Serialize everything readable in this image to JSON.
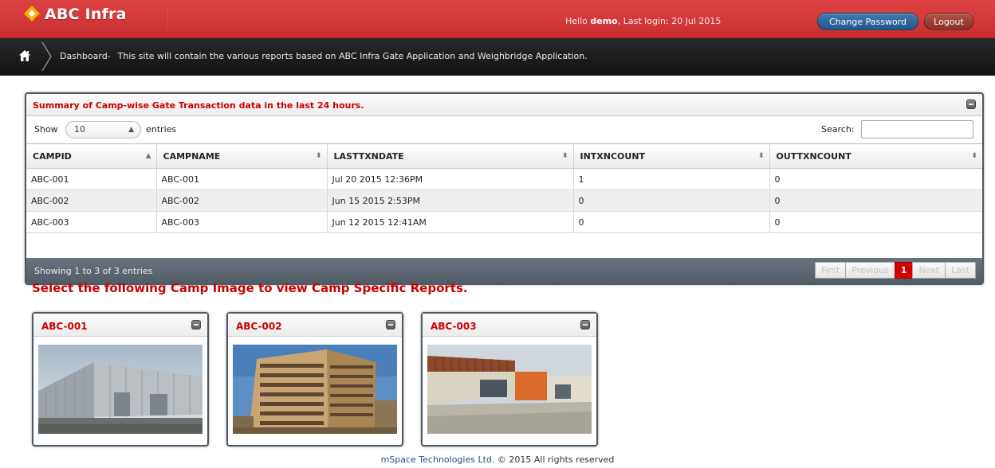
{
  "header": {
    "app_title": "ABC Infra",
    "greeting_prefix": "Hello ",
    "username": "demo",
    "last_login": ", Last login: 20 Jul 2015",
    "change_password_label": "Change Password",
    "logout_label": "Logout"
  },
  "breadcrumb": {
    "page": "Dashboard-",
    "description": "This site will contain the various reports based on ABC Infra Gate Application and Weighbridge Application."
  },
  "summary": {
    "title": "Summary of Camp-wise Gate Transaction data in the last 24 hours.",
    "show_label": "Show",
    "page_length": "10",
    "entries_label": "entries",
    "search_label": "Search:",
    "search_value": "",
    "columns": [
      "CAMPID",
      "CAMPNAME",
      "LASTTXNDATE",
      "INTXNCOUNT",
      "OUTTXNCOUNT"
    ],
    "rows": [
      [
        "ABC-001",
        "ABC-001",
        "Jul 20 2015 12:36PM",
        "1",
        "0"
      ],
      [
        "ABC-002",
        "ABC-002",
        "Jun 15 2015 2:53PM",
        "0",
        "0"
      ],
      [
        "ABC-003",
        "ABC-003",
        "Jun 12 2015 12:41AM",
        "0",
        "0"
      ]
    ],
    "info": "Showing 1 to 3 of 3 entries",
    "pager": {
      "first": "First",
      "previous": "Previous",
      "current": "1",
      "next": "Next",
      "last": "Last"
    }
  },
  "camps": {
    "heading": "Select the following Camp Image to view Camp Specific Reports.",
    "items": [
      {
        "title": "ABC-001"
      },
      {
        "title": "ABC-002"
      },
      {
        "title": "ABC-003"
      }
    ]
  },
  "footer": {
    "company": "mSpace Technologies Ltd.",
    "copyright": " © 2015 All rights reserved"
  },
  "colors": {
    "brand_red": "#d43b3b",
    "accent_red": "#cc0000",
    "nav_dark": "#1a1a1a",
    "panel_border": "#4d5a66"
  }
}
